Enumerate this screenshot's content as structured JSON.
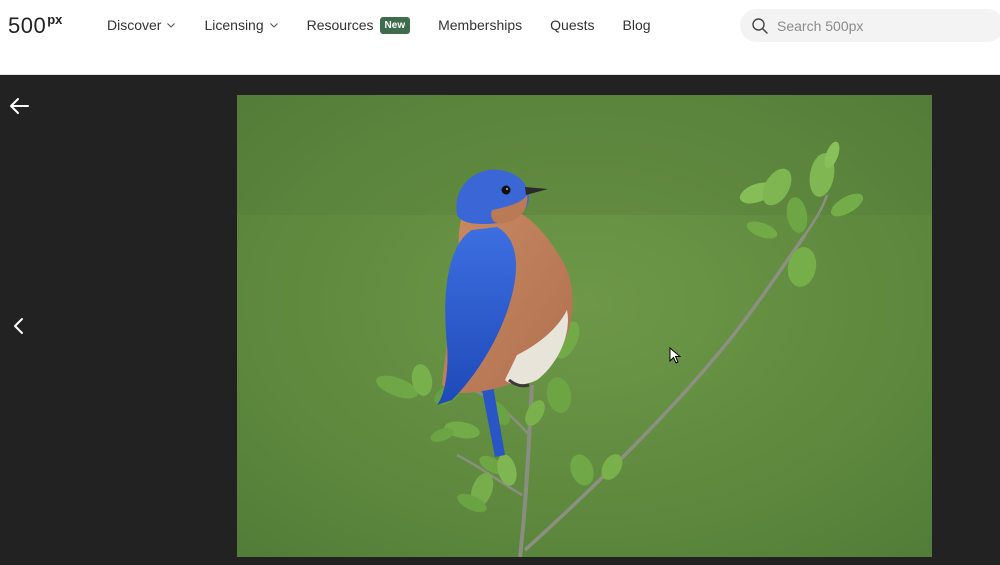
{
  "header": {
    "logo": {
      "number": "500",
      "suffix": "px"
    },
    "nav": [
      {
        "label": "Discover",
        "has_dropdown": true
      },
      {
        "label": "Licensing",
        "has_dropdown": true
      },
      {
        "label": "Resources",
        "badge": "New"
      },
      {
        "label": "Memberships"
      },
      {
        "label": "Quests"
      },
      {
        "label": "Blog"
      }
    ],
    "search": {
      "placeholder": "Search 500px",
      "value": ""
    }
  },
  "viewer": {
    "photo_subject": "bluebird perched on a green twig",
    "icons": {
      "back": "arrow-left-icon",
      "previous": "chevron-left-icon"
    }
  },
  "colors": {
    "viewer_background": "#222223",
    "badge_background": "#3f6c4d",
    "search_background": "#f3f3f3"
  }
}
